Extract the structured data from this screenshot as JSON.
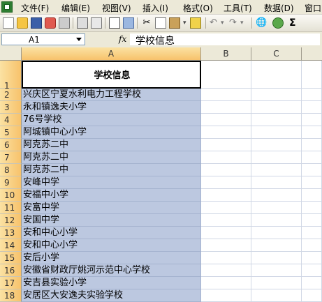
{
  "menu": [
    "文件(F)",
    "编辑(E)",
    "视图(V)",
    "插入(I)",
    "格式(O)",
    "工具(T)",
    "数据(D)",
    "窗口"
  ],
  "name_box": "A1",
  "fx_label": "fx",
  "formula_value": "学校信息",
  "columns": [
    "A",
    "B",
    "C"
  ],
  "rows": [
    {
      "num": "1",
      "value": "学校信息"
    },
    {
      "num": "2",
      "value": "  兴庆区宁夏水利电力工程学校"
    },
    {
      "num": "3",
      "value": "  永和镇逸夫小学"
    },
    {
      "num": "4",
      "value": "76号学校"
    },
    {
      "num": "5",
      "value": "阿城镇中心小学"
    },
    {
      "num": "6",
      "value": "阿克苏二中"
    },
    {
      "num": "7",
      "value": "阿克苏二中"
    },
    {
      "num": "8",
      "value": "阿克苏二中"
    },
    {
      "num": "9",
      "value": "安峰中学"
    },
    {
      "num": "10",
      "value": "安福中小学"
    },
    {
      "num": "11",
      "value": "安富中学"
    },
    {
      "num": "12",
      "value": "安国中学"
    },
    {
      "num": "13",
      "value": "安和中心小学"
    },
    {
      "num": "14",
      "value": "安和中心小学"
    },
    {
      "num": "15",
      "value": "安后小学"
    },
    {
      "num": "16",
      "value": "安徽省财政厅姚河示范中心学校"
    },
    {
      "num": "17",
      "value": "安吉县实验小学"
    },
    {
      "num": "18",
      "value": "安居区大安逸夫实验学校"
    }
  ],
  "toolbar_icons": [
    "new-icon",
    "open-icon",
    "save-icon",
    "permission-icon",
    "print-icon",
    "print-preview-icon",
    "spelling-icon",
    "research-icon",
    "cut-icon",
    "copy-icon",
    "paste-icon",
    "format-painter-icon",
    "undo-icon",
    "redo-icon",
    "hyperlink-icon",
    "autosum-icon"
  ]
}
